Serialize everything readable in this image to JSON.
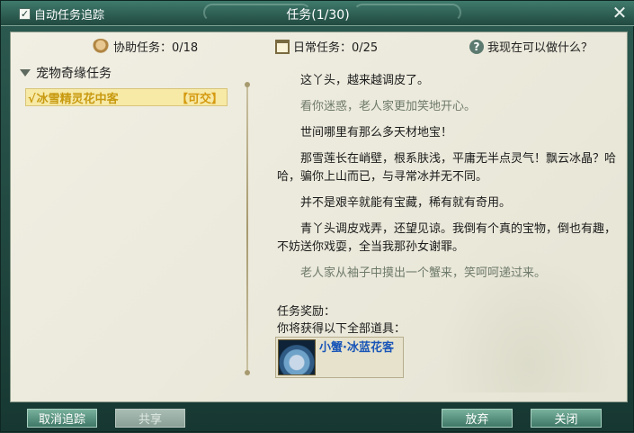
{
  "titlebar": {
    "auto_track_label": "自动任务追踪",
    "auto_track_checked": true,
    "title": "任务(1/30)",
    "close_glyph": "✕"
  },
  "stats": {
    "assist": "协助任务：0/18",
    "daily": "日常任务：0/25",
    "help": "我现在可以做什么？"
  },
  "quest_list": {
    "category": "宠物奇缘任务",
    "quests": [
      {
        "name": "冰雪精灵花中客",
        "status": "【可交】",
        "selected": true
      }
    ]
  },
  "story": [
    {
      "text": "这丫头，越来越调皮了。",
      "muted": false
    },
    {
      "text": "看你迷惑，老人家更加笑地开心。",
      "muted": true
    },
    {
      "text": "世间哪里有那么多天材地宝！",
      "muted": false
    },
    {
      "text": "那雪莲长在峭壁，根系肤浅，平庸无半点灵气！飘云冰晶？哈哈，骗你上山而已，与寻常冰并无不同。",
      "muted": false
    },
    {
      "text": "并不是艰辛就能有宝藏，稀有就有奇用。",
      "muted": false
    },
    {
      "text": "青丫头调皮戏弄，还望见谅。我倒有个真的宝物，倒也有趣，不妨送你戏耍，全当我那孙女谢罪。",
      "muted": false
    },
    {
      "text": "老人家从袖子中摸出一个蟹来，笑呵呵递过来。",
      "muted": true
    }
  ],
  "reward": {
    "title": "任务奖励：",
    "subtitle": "你将获得以下全部道具：",
    "item_name": "小蟹·冰蓝花客"
  },
  "buttons": {
    "untrack": "取消追踪",
    "share": "共享",
    "abandon": "放弃",
    "close": "关闭"
  },
  "colors": {
    "title_bar": "#2c5a50",
    "panel_bg": "#efeddf",
    "quest_highlight": "#f7e9a6",
    "quest_text": "#c89a10",
    "item_name": "#1a56b8",
    "muted_text": "#6e7a6a",
    "button": "#4e8a78"
  }
}
